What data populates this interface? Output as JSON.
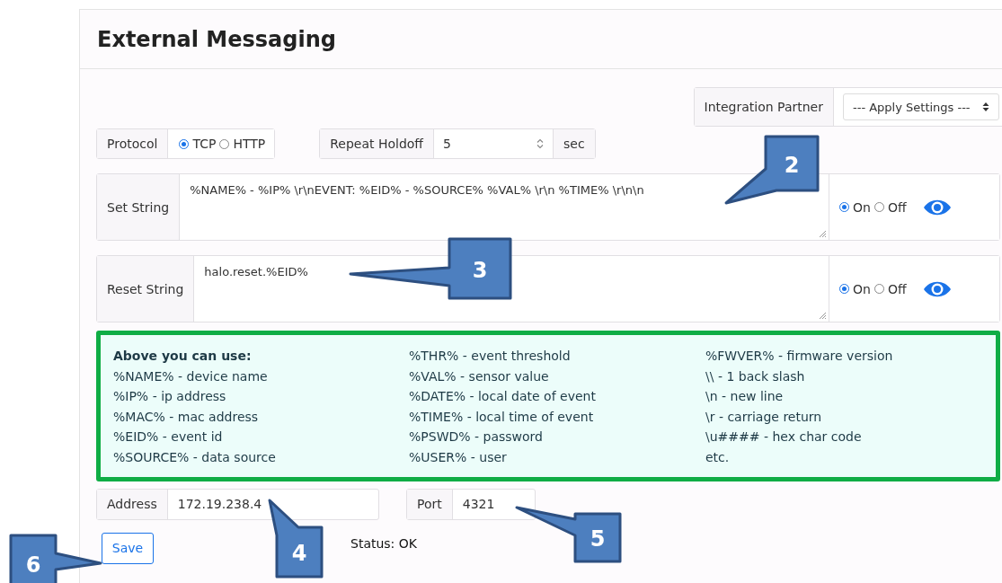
{
  "title": "External Messaging",
  "integration_partner": {
    "label": "Integration Partner",
    "value": "--- Apply Settings ---"
  },
  "protocol": {
    "label": "Protocol",
    "options": [
      {
        "label": "TCP",
        "selected": true
      },
      {
        "label": "HTTP",
        "selected": false
      }
    ]
  },
  "repeat_holdoff": {
    "label": "Repeat Holdoff",
    "value": "5",
    "unit": "sec"
  },
  "strings": [
    {
      "label": "Set String",
      "value": "%NAME% - %IP% \\r\\nEVENT: %EID% - %SOURCE% %VAL% \\r\\n %TIME% \\r\\n\\n",
      "options": [
        {
          "label": "On",
          "selected": true
        },
        {
          "label": "Off",
          "selected": false
        }
      ]
    },
    {
      "label": "Reset String",
      "value": "halo.reset.%EID%",
      "options": [
        {
          "label": "On",
          "selected": true
        },
        {
          "label": "Off",
          "selected": false
        }
      ]
    }
  ],
  "help": {
    "heading": "Above you can use:",
    "columns": [
      [
        "%NAME% - device name",
        "%IP% - ip address",
        "%MAC% - mac address",
        "%EID% - event id",
        "%SOURCE% - data source"
      ],
      [
        "%THR% - event threshold",
        "%VAL% - sensor value",
        "%DATE% - local date of event",
        "%TIME% - local time of event",
        "%PSWD% - password",
        "%USER% - user"
      ],
      [
        "%FWVER% - firmware version",
        "\\\\ - 1 back slash",
        "\\n - new line",
        "\\r - carriage return",
        "\\u#### - hex char code",
        "etc."
      ]
    ]
  },
  "address": {
    "label": "Address",
    "value": "172.19.238.4"
  },
  "port": {
    "label": "Port",
    "value": "4321"
  },
  "save": "Save",
  "status": "Status: OK",
  "callouts": [
    {
      "number": "2"
    },
    {
      "number": "3"
    },
    {
      "number": "4"
    },
    {
      "number": "5"
    },
    {
      "number": "6"
    }
  ]
}
